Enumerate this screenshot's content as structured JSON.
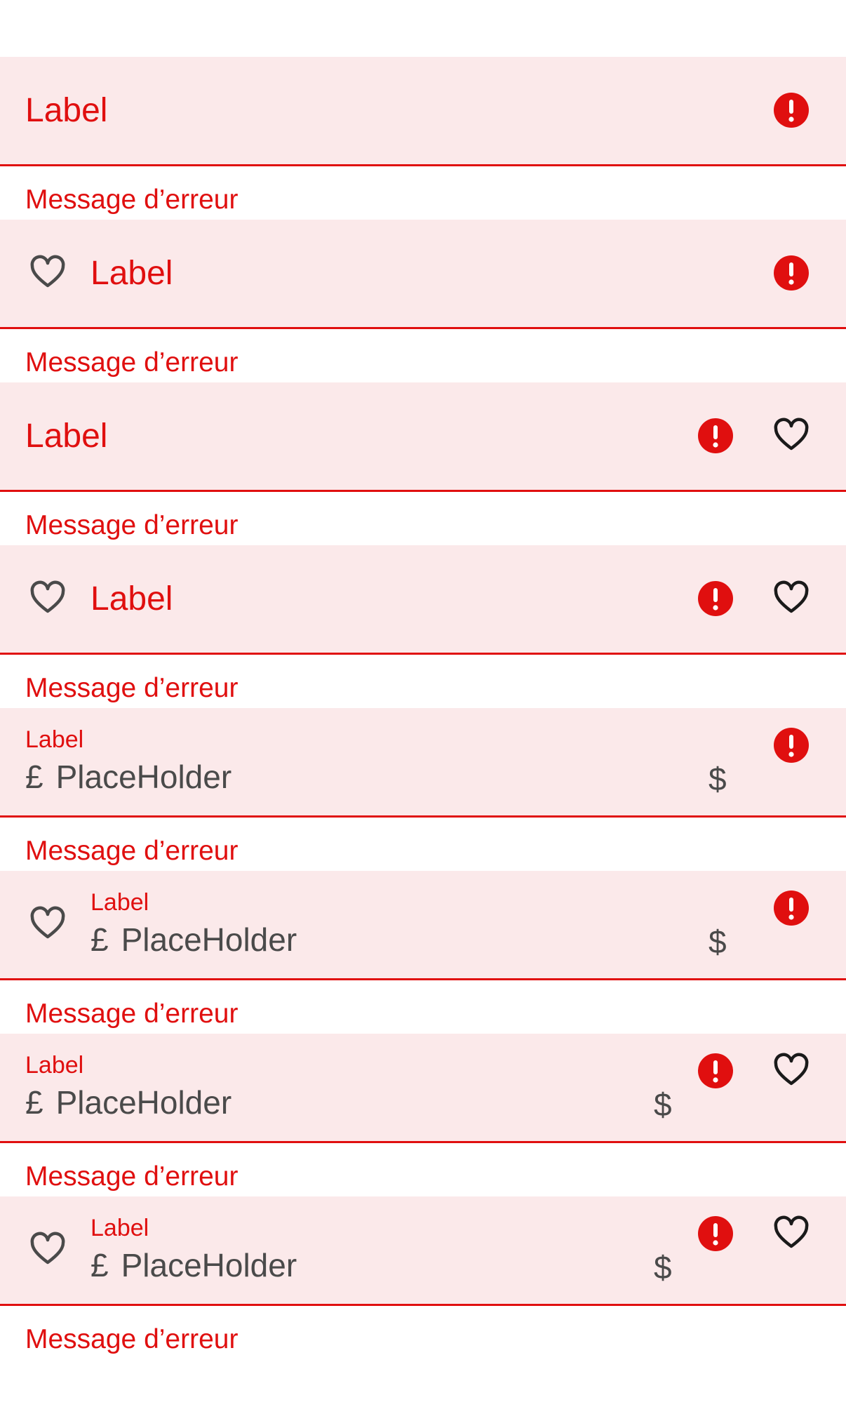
{
  "fields": [
    {
      "label": "Label",
      "error_message": "Message d’erreur"
    },
    {
      "label": "Label",
      "error_message": "Message d’erreur"
    },
    {
      "label": "Label",
      "error_message": "Message d’erreur"
    },
    {
      "label": "Label",
      "error_message": "Message d’erreur"
    },
    {
      "label": "Label",
      "prefix": "£",
      "placeholder": "PlaceHolder",
      "suffix": "$",
      "error_message": "Message d’erreur"
    },
    {
      "label": "Label",
      "prefix": "£",
      "placeholder": "PlaceHolder",
      "suffix": "$",
      "error_message": "Message d’erreur"
    },
    {
      "label": "Label",
      "prefix": "£",
      "placeholder": "PlaceHolder",
      "suffix": "$",
      "error_message": "Message d’erreur"
    },
    {
      "label": "Label",
      "prefix": "£",
      "placeholder": "PlaceHolder",
      "suffix": "$",
      "error_message": "Message d’erreur"
    }
  ],
  "colors": {
    "error": "#e00f0f",
    "field_background": "#fbe9ea",
    "input_text": "#4a4a4a",
    "icon_heart_left": "#4a4a4a",
    "icon_heart_right": "#1a1a1a"
  },
  "icons": {
    "error": "alert-circle-icon",
    "favorite": "heart-icon"
  }
}
